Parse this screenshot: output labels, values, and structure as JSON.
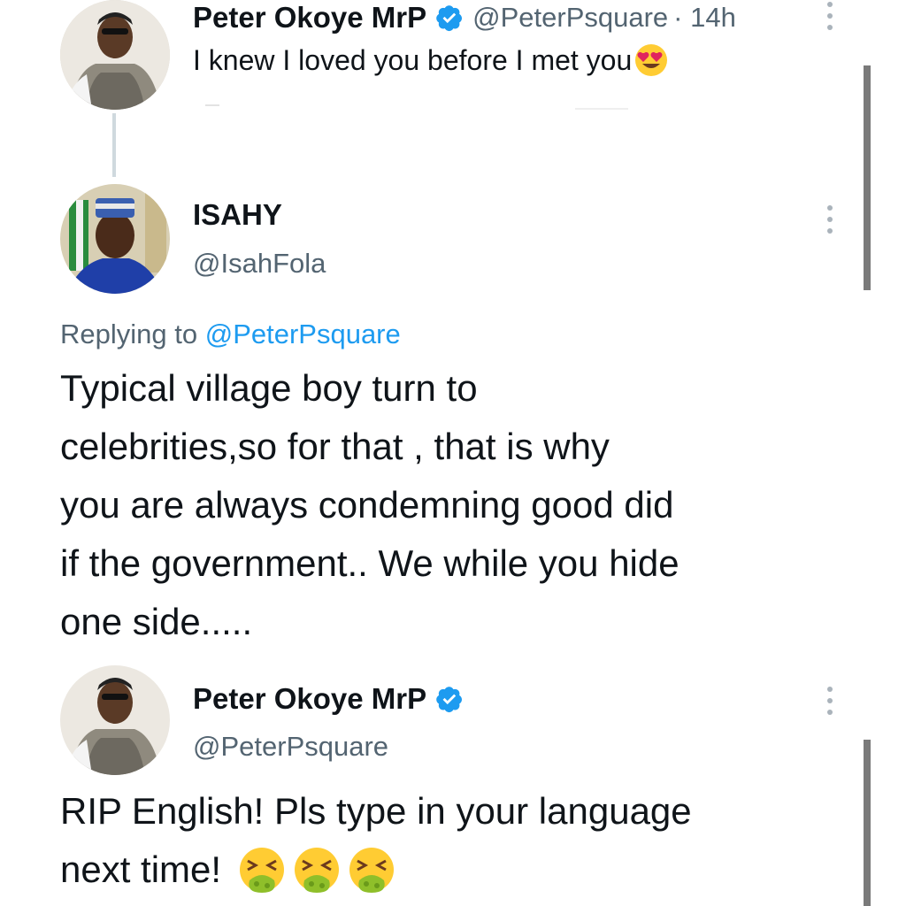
{
  "tweet1": {
    "name": "Peter Okoye MrP",
    "handle": "@PeterPsquare",
    "time": "· 14h",
    "text": "I knew I loved you before I met you",
    "emoji": "smiling-face-with-heart-eyes"
  },
  "tweet2": {
    "name": "ISAHY",
    "handle": "@IsahFola",
    "replying_prefix": "Replying to",
    "replying_to": "@PeterPsquare",
    "lines": [
      "Typical village boy turn to",
      "celebrities,so for that , that is why",
      "you are always condemning good did",
      "if the government.. We while you hide",
      "one side....."
    ]
  },
  "tweet3": {
    "name": "Peter Okoye MrP",
    "handle": "@PeterPsquare",
    "lines": [
      "RIP English! Pls type in your language",
      "next time!"
    ],
    "emojis": [
      "nauseated-face",
      "nauseated-face",
      "nauseated-face"
    ]
  },
  "colors": {
    "verified": "#1d9bf0",
    "handle": "#536471",
    "reply_link": "#1d9bf0",
    "text": "#0f1419"
  }
}
